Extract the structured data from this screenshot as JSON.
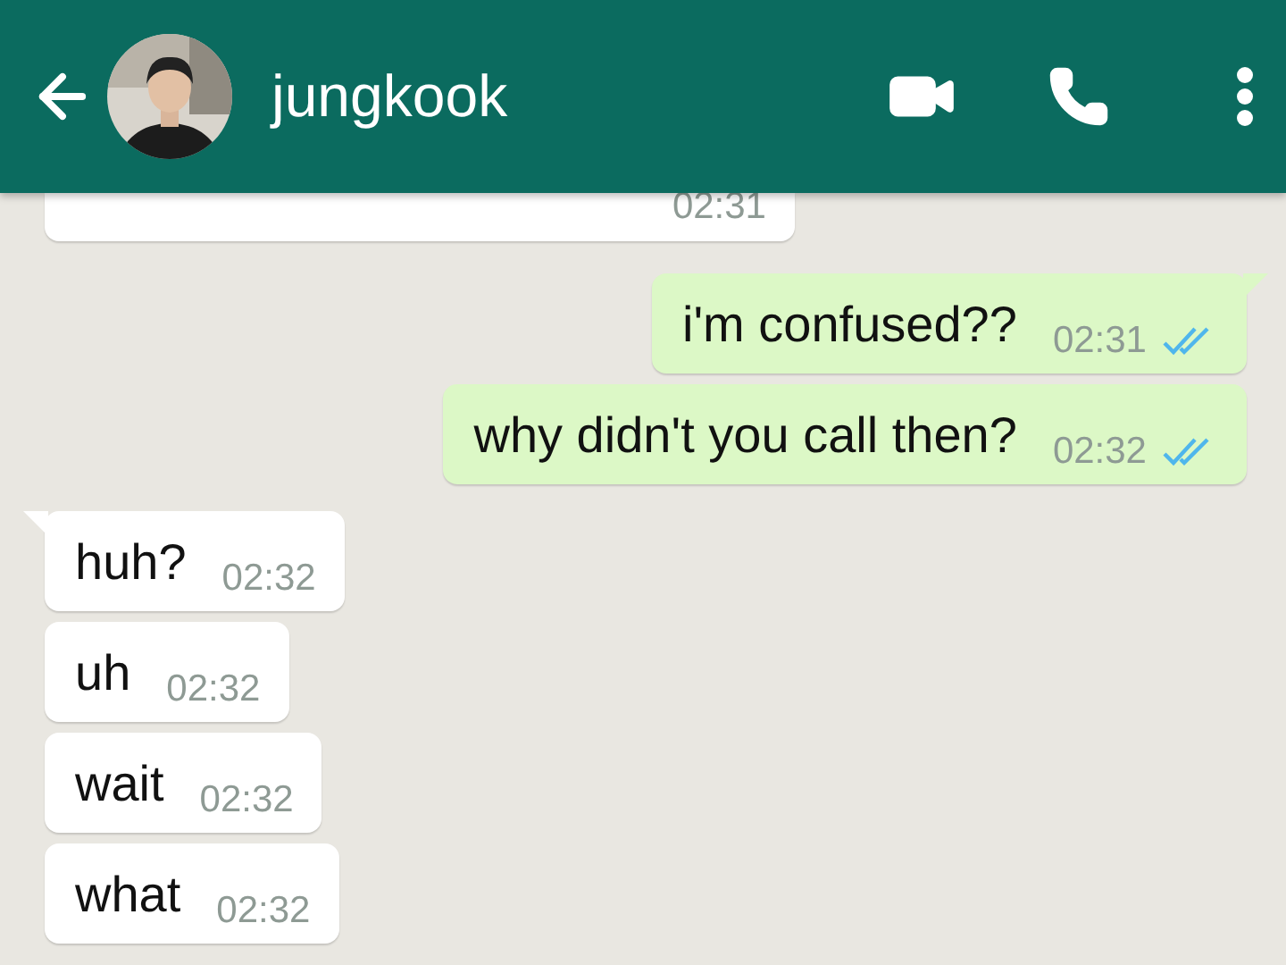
{
  "header": {
    "contact_name": "jungkook"
  },
  "messages": [
    {
      "kind": "incoming",
      "time": "02:31"
    },
    {
      "kind": "outgoing",
      "text": "i'm confused??",
      "time": "02:31",
      "tail": true,
      "read": true
    },
    {
      "kind": "outgoing",
      "text": "why didn't you call then?",
      "time": "02:32",
      "tail": false,
      "read": true
    },
    {
      "kind": "incoming",
      "text": "huh?",
      "time": "02:32",
      "tail": true
    },
    {
      "kind": "incoming",
      "text": "uh",
      "time": "02:32",
      "tail": false
    },
    {
      "kind": "incoming",
      "text": "wait",
      "time": "02:32",
      "tail": false
    },
    {
      "kind": "incoming",
      "text": "what",
      "time": "02:32",
      "tail": false
    }
  ]
}
